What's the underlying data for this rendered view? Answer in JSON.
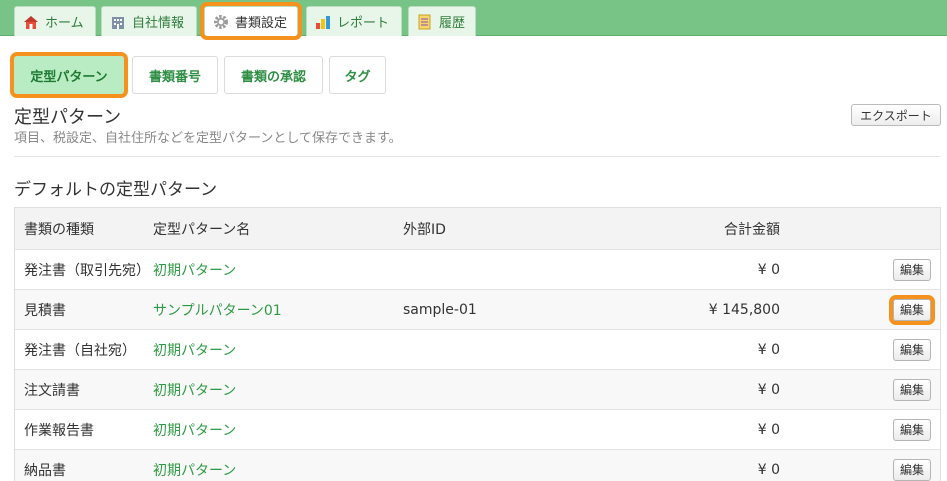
{
  "top_tabs": [
    {
      "label": "ホーム",
      "icon": "home-icon"
    },
    {
      "label": "自社情報",
      "icon": "building-icon"
    },
    {
      "label": "書類設定",
      "icon": "gear-icon",
      "active": true
    },
    {
      "label": "レポート",
      "icon": "bar-chart-icon"
    },
    {
      "label": "履歴",
      "icon": "history-icon"
    }
  ],
  "sub_tabs": [
    {
      "label": "定型パターン",
      "active": true
    },
    {
      "label": "書類番号"
    },
    {
      "label": "書類の承認"
    },
    {
      "label": "タグ"
    }
  ],
  "section": {
    "title": "定型パターン",
    "description": "項目、税設定、自社住所などを定型パターンとして保存できます。",
    "export_label": "エクスポート"
  },
  "default_heading": "デフォルトの定型パターン",
  "table": {
    "headers": {
      "type": "書類の種類",
      "name": "定型パターン名",
      "external_id": "外部ID",
      "total": "合計金額"
    },
    "rows": [
      {
        "type": "発注書（取引先宛）",
        "name": "初期パターン",
        "external_id": "",
        "total": "¥ 0",
        "edit": "編集"
      },
      {
        "type": "見積書",
        "name": "サンプルパターン01",
        "external_id": "sample-01",
        "total": "¥ 145,800",
        "edit": "編集"
      },
      {
        "type": "発注書（自社宛）",
        "name": "初期パターン",
        "external_id": "",
        "total": "¥ 0",
        "edit": "編集"
      },
      {
        "type": "注文請書",
        "name": "初期パターン",
        "external_id": "",
        "total": "¥ 0",
        "edit": "編集"
      },
      {
        "type": "作業報告書",
        "name": "初期パターン",
        "external_id": "",
        "total": "¥ 0",
        "edit": "編集"
      },
      {
        "type": "納品書",
        "name": "初期パターン",
        "external_id": "",
        "total": "¥ 0",
        "edit": "編集"
      }
    ]
  },
  "colors": {
    "accent_green": "#2f9a45",
    "highlight_orange": "#f5921e",
    "tabbar_green": "#78c486"
  }
}
